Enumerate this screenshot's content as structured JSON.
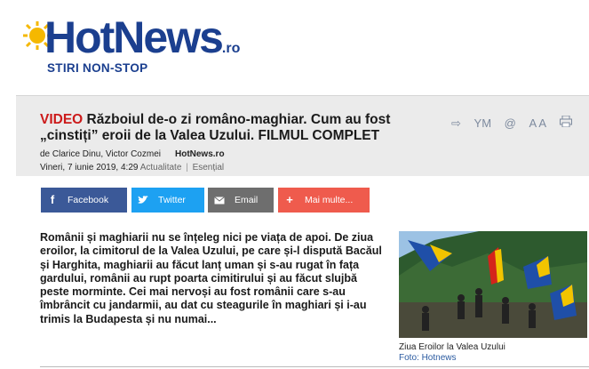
{
  "brand": {
    "logo_text": "HotNews",
    "logo_tld": ".ro",
    "tagline": "STIRI NON-STOP",
    "color": "#1b3f8f"
  },
  "article": {
    "video_label": "VIDEO",
    "title": " Războiul de-o zi româno-maghiar. Cum au fost „cinstiți” eroii de la Valea Uzului. FILMUL COMPLET",
    "byline": "de Clarice Dinu, Victor Cozmei",
    "source": "HotNews.ro",
    "date": "Vineri, 7 iunie 2019, 4:29",
    "category1": "Actualitate",
    "separator": "|",
    "category2": "Esențial",
    "lead": "Românii și maghiarii nu se înțeleg nici pe viața de apoi. De ziua eroilor, la cimitorul de la Valea Uzului, pe care și-l dispută Bacăul și Harghita, maghiarii au făcut lanț uman și s-au rugat în fața gardului, românii au rupt poarta cimitirului și au făcut slujbă peste morminte. Cei mai nervoși au fost românii care s-au îmbrâncit cu jandarmii, au dat cu steagurile în maghiari și i-au trimis la Budapesta și nu numai...",
    "photo_caption": "Ziua Eroilor la Valea Uzului",
    "photo_credit": "Foto: Hotnews"
  },
  "tools": {
    "share_icon": "⇨",
    "ym": "YM",
    "email_icon": "@",
    "font_size": "A A",
    "print_icon": "print-icon"
  },
  "share": {
    "facebook": "Facebook",
    "twitter": "Twitter",
    "email": "Email",
    "more": "Mai multe..."
  }
}
